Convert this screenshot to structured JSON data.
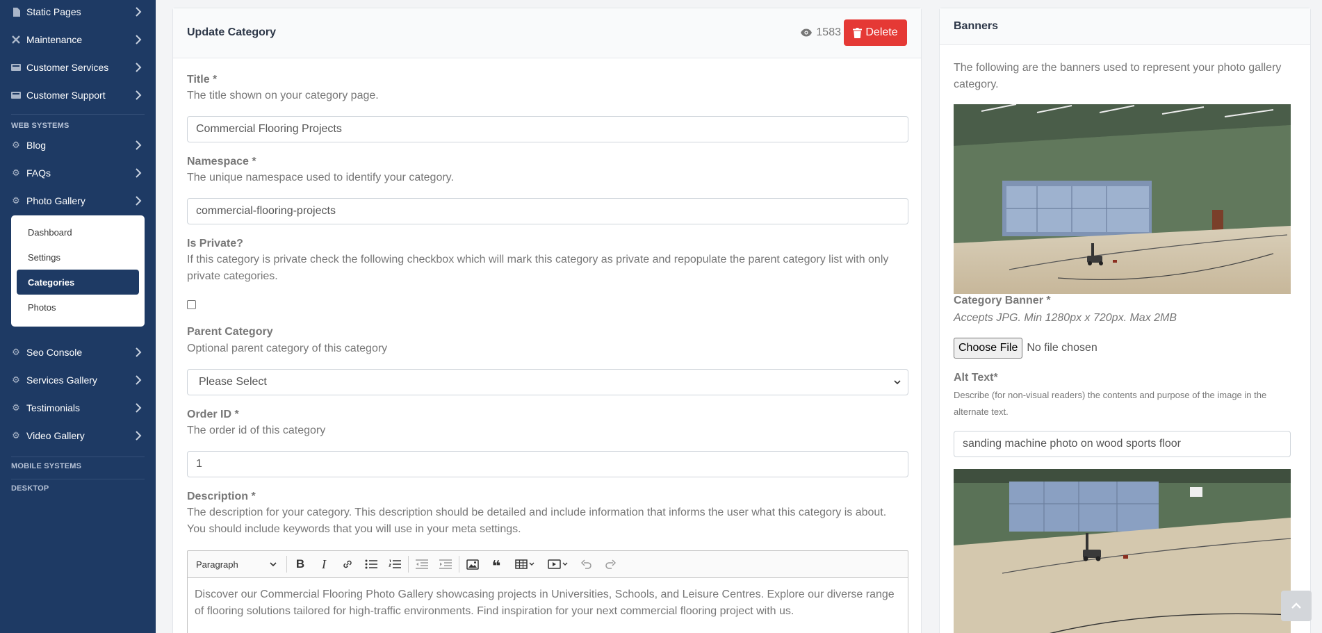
{
  "sidebar": {
    "items_top": [
      {
        "label": "Static Pages",
        "icon": "document-icon"
      },
      {
        "label": "Maintenance",
        "icon": "tools-icon"
      },
      {
        "label": "Customer Services",
        "icon": "keyboard-icon"
      },
      {
        "label": "Customer Support",
        "icon": "keyboard-icon"
      }
    ],
    "section_web": "WEB SYSTEMS",
    "items_web": [
      {
        "label": "Blog",
        "icon": "gear-icon"
      },
      {
        "label": "FAQs",
        "icon": "gear-icon"
      },
      {
        "label": "Photo Gallery",
        "icon": "gear-icon"
      }
    ],
    "submenu": [
      "Dashboard",
      "Settings",
      "Categories",
      "Photos"
    ],
    "submenu_active": "Categories",
    "items_web2": [
      {
        "label": "Seo Console",
        "icon": "gear-icon"
      },
      {
        "label": "Services Gallery",
        "icon": "gear-icon"
      },
      {
        "label": "Testimonials",
        "icon": "gear-icon"
      },
      {
        "label": "Video Gallery",
        "icon": "gear-icon"
      }
    ],
    "section_mobile": "MOBILE SYSTEMS",
    "section_desktop": "DESKTOP"
  },
  "main": {
    "title": "Update Category",
    "views": "1583",
    "delete_label": "Delete",
    "fields": {
      "title_label": "Title *",
      "title_help": "The title shown on your category page.",
      "title_value": "Commercial Flooring Projects",
      "namespace_label": "Namespace *",
      "namespace_help": "The unique namespace used to identify your category.",
      "namespace_value": "commercial-flooring-projects",
      "private_label": "Is Private?",
      "private_help_1": "If this category is private check the following checkbox which will mark this category as private and repopulate the parent category list with only",
      "private_help_2": "private categories.",
      "parent_label": "Parent Category",
      "parent_help": "Optional parent category of this category",
      "parent_value": "Please Select",
      "order_label": "Order ID *",
      "order_help": "The order id of this category",
      "order_value": "1",
      "desc_label": "Description *",
      "desc_help_1": "The description for your category. This description should be detailed and include information that informs the user what this category is about.",
      "desc_help_2": "You should include keywords that you will use in your meta settings.",
      "editor_format": "Paragraph",
      "desc_value_1": "Discover our Commercial Flooring Photo Gallery showcasing projects in Universities, Schools, and Leisure Centres. Explore our diverse range",
      "desc_value_2": "of flooring solutions tailored for high-traffic environments. Find inspiration for your next commercial flooring project with us."
    }
  },
  "banners": {
    "title": "Banners",
    "intro_1": "The following are the banners used to represent your photo gallery",
    "intro_2": "category.",
    "banner_label": "Category Banner *",
    "banner_help": "Accepts JPG. Min 1280px x 720px. Max 2MB",
    "choose_file": "Choose File",
    "no_file": "No file chosen",
    "alt_label": "Alt Text*",
    "alt_help_1": "Describe (for non-visual readers) the contents and purpose of the image in the",
    "alt_help_2": "alternate text.",
    "alt_value": "sanding machine photo on wood sports floor"
  },
  "colors": {
    "sidebar_bg": "#1e3a64",
    "delete_red": "#e53935"
  }
}
